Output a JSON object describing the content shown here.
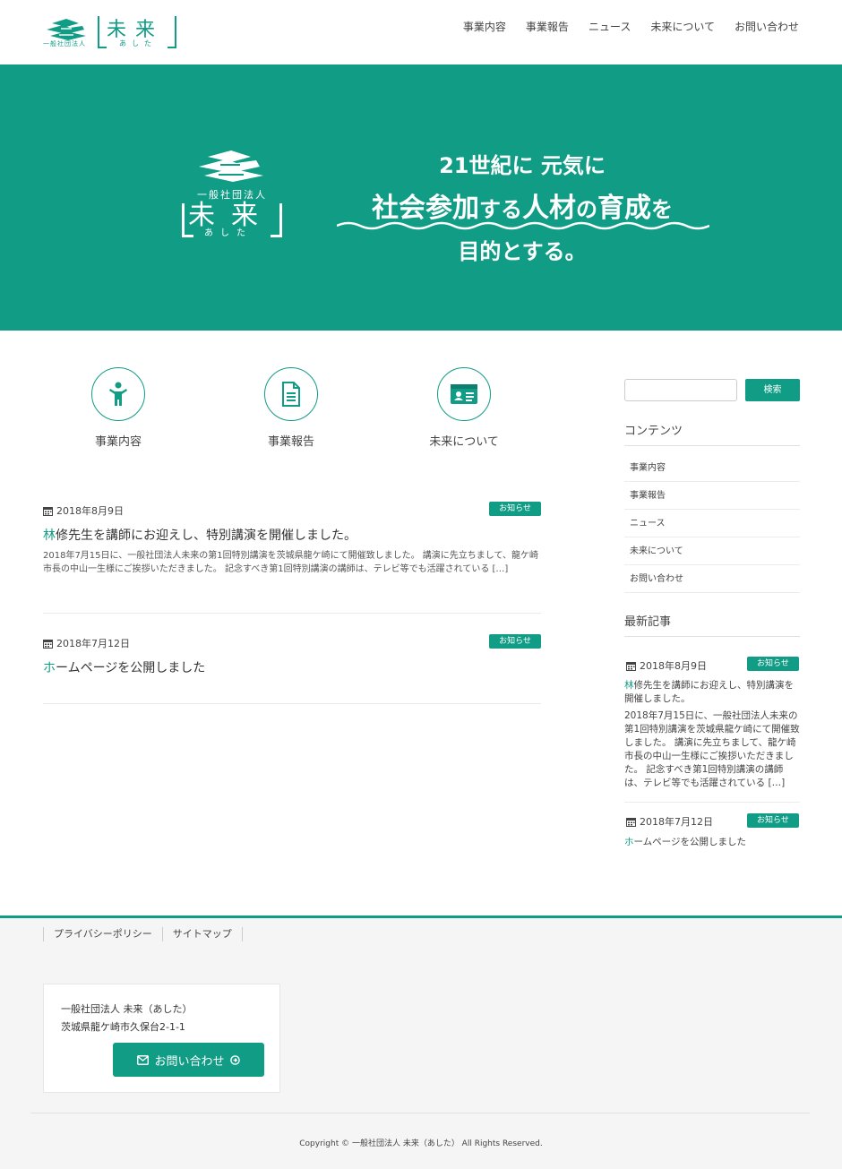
{
  "colors": {
    "accent": "#119c86",
    "footer_bg": "#f5f5f5"
  },
  "header": {
    "logo": {
      "org": "一般社団法人",
      "name": "未来",
      "kana": "あした"
    },
    "nav": [
      "事業内容",
      "事業報告",
      "ニュース",
      "未来について",
      "お問い合わせ"
    ]
  },
  "hero": {
    "logo": {
      "org": "一般社団法人",
      "name": "未来",
      "kana": "あした"
    },
    "line1": "21世紀に 元気に",
    "line2": {
      "a": "社会参加",
      "b": "する",
      "c": "人材",
      "d": "の",
      "e": "育成",
      "f": "を"
    },
    "line3": "目的とする。"
  },
  "features": [
    {
      "label": "事業内容",
      "icon": "child-icon"
    },
    {
      "label": "事業報告",
      "icon": "document-icon"
    },
    {
      "label": "未来について",
      "icon": "id-card-icon"
    }
  ],
  "posts": [
    {
      "date": "2018年8月9日",
      "badge": "お知らせ",
      "title_first": "林",
      "title_rest": "修先生を講師にお迎えし、特別講演を開催しました。",
      "excerpt": "2018年7月15日に、一般社団法人未来の第1回特別講演を茨城県龍ケ崎にて開催致しました。 講演に先立ちまして、龍ケ崎市長の中山一生様にご挨拶いただきました。 記念すべき第1回特別講演の講師は、テレビ等でも活躍されている […]"
    },
    {
      "date": "2018年7月12日",
      "badge": "お知らせ",
      "title_first": "ホ",
      "title_rest": "ームページを公開しました",
      "excerpt": ""
    }
  ],
  "sidebar": {
    "search_button": "検索",
    "contents_heading": "コンテンツ",
    "contents": [
      "事業内容",
      "事業報告",
      "ニュース",
      "未来について",
      "お問い合わせ"
    ],
    "recent_heading": "最新記事",
    "recent": [
      {
        "date": "2018年8月9日",
        "badge": "お知らせ",
        "title_first": "林",
        "title_rest": "修先生を講師にお迎えし、特別講演を開催しました。",
        "excerpt": "2018年7月15日に、一般社団法人未来の第1回特別講演を茨城県龍ケ崎にて開催致しました。 講演に先立ちまして、龍ケ崎市長の中山一生様にご挨拶いただきました。 記念すべき第1回特別講演の講師は、テレビ等でも活躍されている […]"
      },
      {
        "date": "2018年7月12日",
        "badge": "お知らせ",
        "title_first": "ホ",
        "title_rest": "ームページを公開しました",
        "excerpt": ""
      }
    ]
  },
  "footer": {
    "links": [
      "プライバシーポリシー",
      "サイトマップ"
    ],
    "org": "一般社団法人 未来（あした）",
    "address": "茨城県龍ケ崎市久保台2-1-1",
    "contact_button": "お問い合わせ",
    "copyright": "Copyright © 一般社団法人 未来（あした） All Rights Reserved."
  }
}
